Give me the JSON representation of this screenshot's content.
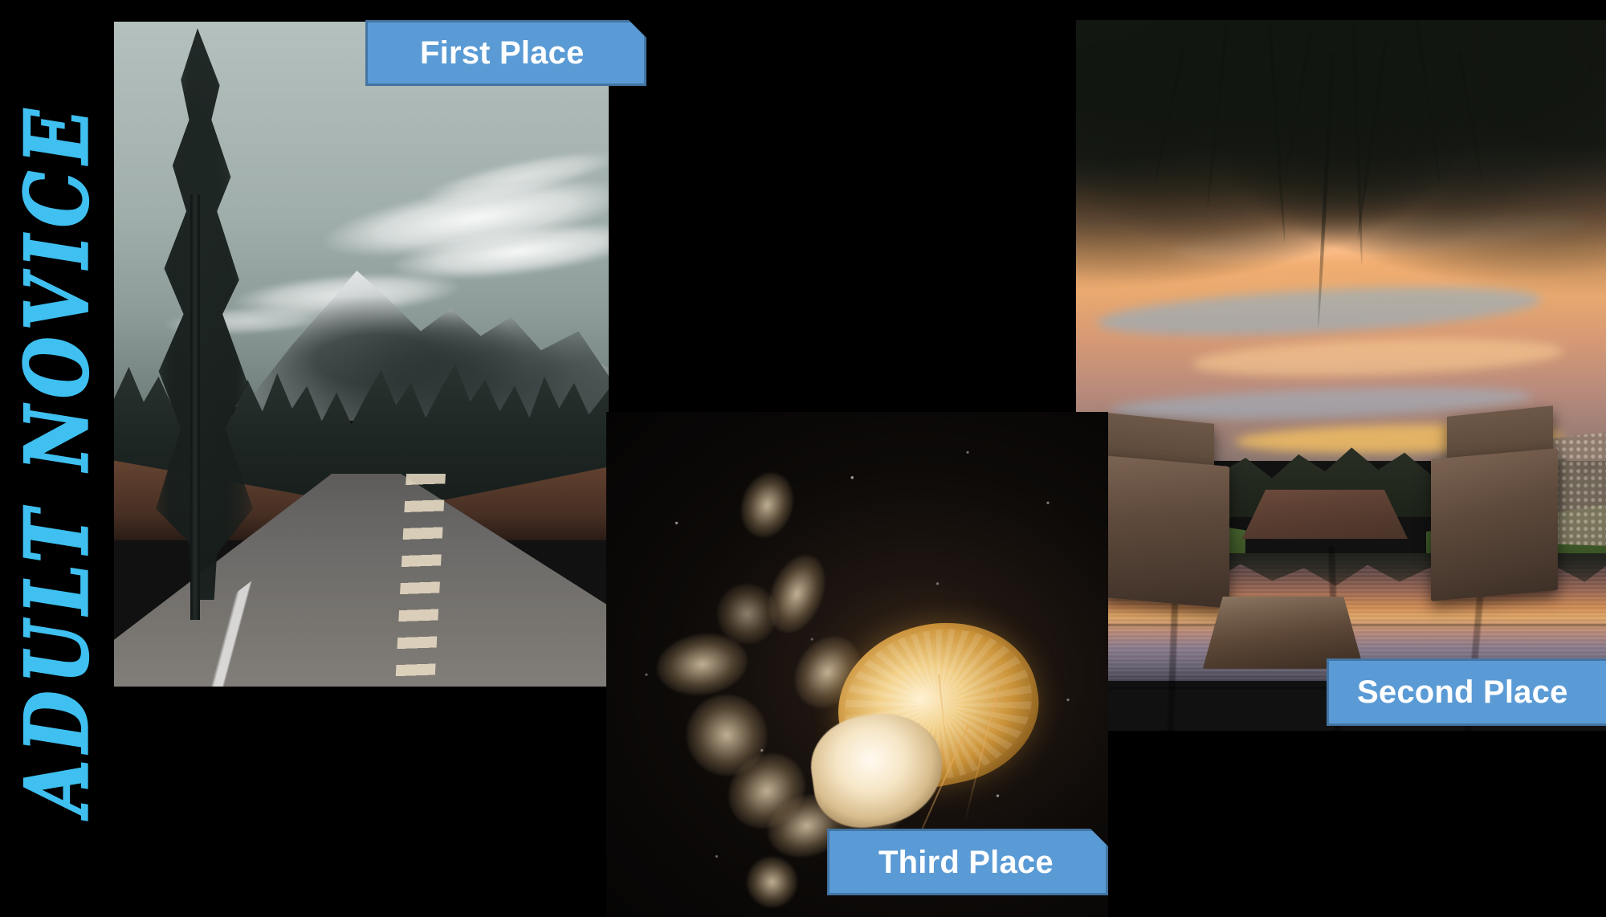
{
  "slide": {
    "background_color": "#000000",
    "category_title": "ADULT NOVICE",
    "category_title_color": "#3fc0f0",
    "accent_color": "#5b9bd5",
    "label_text_color": "#ffffff"
  },
  "awards": [
    {
      "rank": 1,
      "label": "First Place",
      "photo_name": "mountain-road-photo",
      "photo_description": "Desaturated teal-toned photograph of a two-lane road leading toward a snow-capped mountain framed by tall conifer trees"
    },
    {
      "rank": 2,
      "label": "Second Place",
      "photo_name": "sunset-pond-photo",
      "photo_description": "Orange and purple sunset over a still pond with reflections, framed by willow branches, rustic wooden chairs and a table on stone paving in the foreground"
    },
    {
      "rank": 3,
      "label": "Third Place",
      "photo_name": "jellyfish-photo",
      "photo_description": "Golden amber jellyfish with trailing tentacles floating in near-black water speckled with white particles"
    }
  ]
}
